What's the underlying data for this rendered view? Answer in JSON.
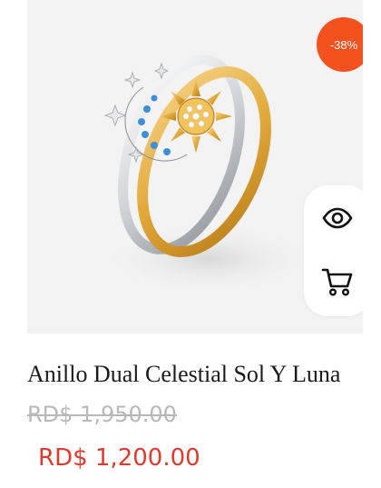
{
  "product": {
    "discount_badge": "-38%",
    "title": "Anillo Dual Celestial Sol Y Luna",
    "price_original": "RD$ 1,950.00",
    "price_sale": "RD$ 1,200.00",
    "image_subject": "silver moon ring and gold sun ring stacked"
  },
  "actions": {
    "quick_view_icon": "eye-icon",
    "add_to_cart_icon": "cart-icon"
  },
  "colors": {
    "badge": "#f4511e",
    "sale_price": "#e03a2c",
    "original_price": "#b8b8b8"
  }
}
